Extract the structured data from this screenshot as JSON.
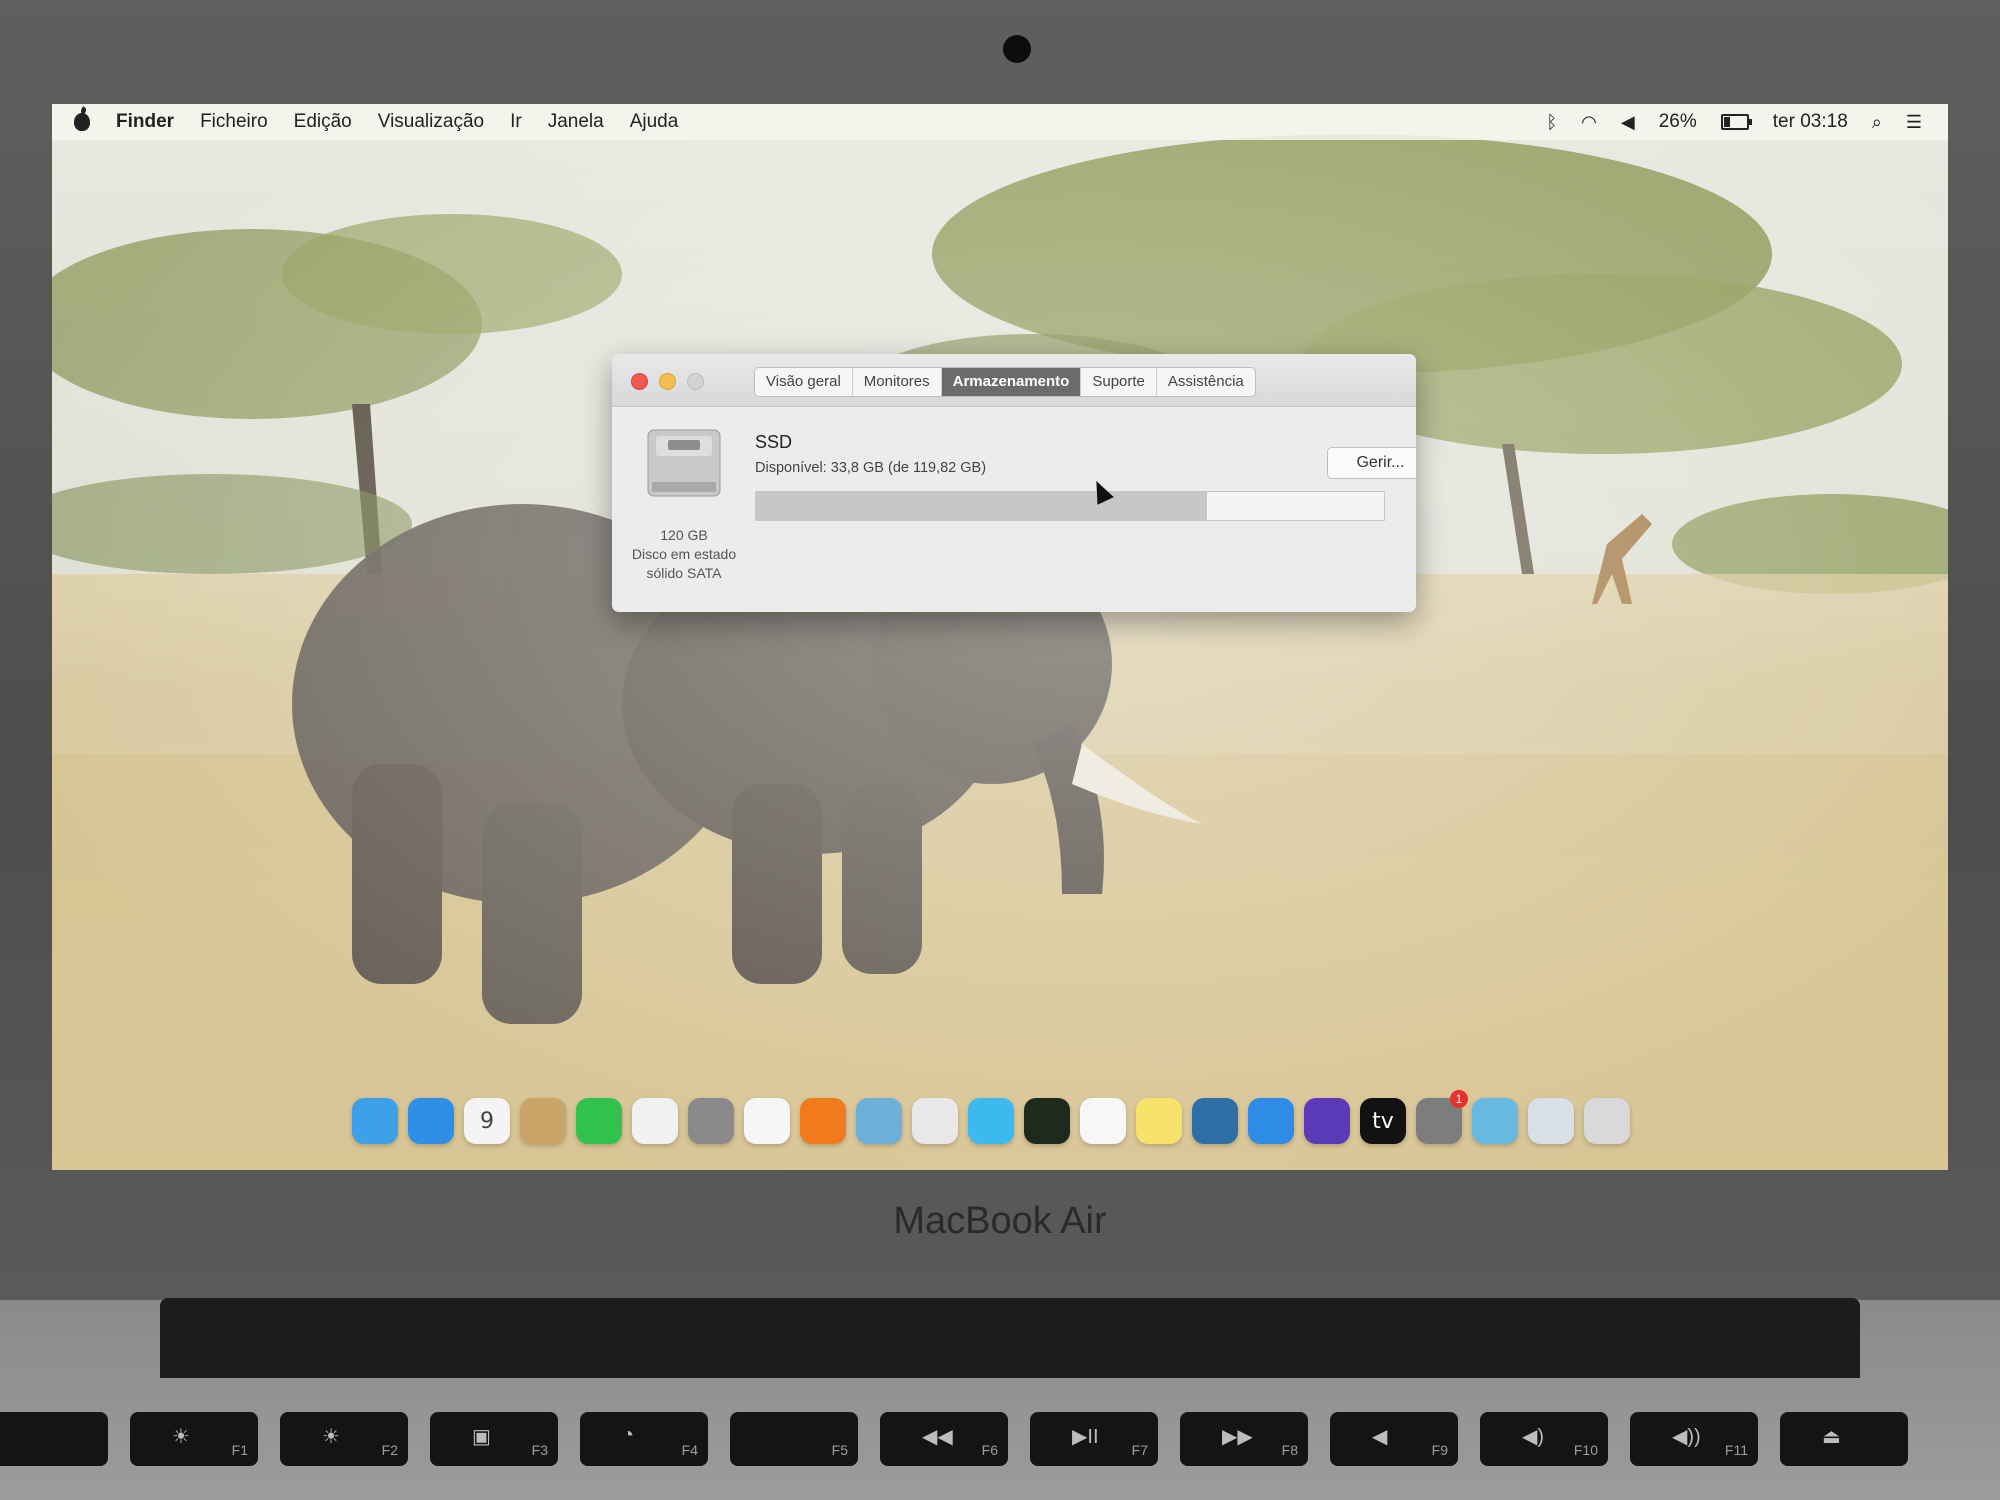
{
  "menubar": {
    "app_name": "Finder",
    "menus": [
      "Ficheiro",
      "Edição",
      "Visualização",
      "Ir",
      "Janela",
      "Ajuda"
    ],
    "battery_percent_label": "26%",
    "battery_level": 0.26,
    "clock": "ter 03:18",
    "icons": [
      "bluetooth-icon",
      "wifi-icon",
      "volume-icon",
      "battery-icon",
      "spotlight-icon",
      "notification-center-icon"
    ]
  },
  "about_window": {
    "tabs": [
      "Visão geral",
      "Monitores",
      "Armazenamento",
      "Suporte",
      "Assistência"
    ],
    "active_tab": "Armazenamento",
    "disk": {
      "name": "SSD",
      "available": "Disponível: 33,8 GB (de 119,82 GB)",
      "size": "120 GB",
      "type_line1": "Disco em estado",
      "type_line2": "sólido SATA",
      "used_fraction": 0.718
    },
    "manage_button": "Gerir..."
  },
  "dock": {
    "items": [
      {
        "name": "finder-icon",
        "color": "#3ea0e8"
      },
      {
        "name": "app-store-icon",
        "color": "#2f8fe6"
      },
      {
        "name": "calendar-icon",
        "color": "#f4f4f4",
        "text": "9"
      },
      {
        "name": "contacts-icon",
        "color": "#c9a56a"
      },
      {
        "name": "facetime-icon",
        "color": "#31c24d"
      },
      {
        "name": "photos-icon",
        "color": "#f1f1f1"
      },
      {
        "name": "launchpad-icon",
        "color": "#8a8a8a"
      },
      {
        "name": "reminders-icon",
        "color": "#f6f6f6"
      },
      {
        "name": "books-icon",
        "color": "#f07a1c"
      },
      {
        "name": "preview-icon",
        "color": "#6ab0d8"
      },
      {
        "name": "script-editor-icon",
        "color": "#e8e8e8"
      },
      {
        "name": "messages-icon",
        "color": "#3cb9ef"
      },
      {
        "name": "activity-monitor-icon",
        "color": "#1e2a1e"
      },
      {
        "name": "music-icon",
        "color": "#f7f7f7"
      },
      {
        "name": "notes-icon",
        "color": "#f7e36a"
      },
      {
        "name": "quicktime-icon",
        "color": "#2d6fa6"
      },
      {
        "name": "safari-icon",
        "color": "#2f8ce6"
      },
      {
        "name": "siri-icon",
        "color": "#5b3ab8"
      },
      {
        "name": "apple-tv-icon",
        "color": "#111111",
        "text": "tv"
      },
      {
        "name": "system-preferences-icon",
        "color": "#7d7d7d",
        "badge": "1"
      },
      {
        "name": "downloads-folder-icon",
        "color": "#67b9e0"
      },
      {
        "name": "finder-window-icon",
        "color": "#d8dfe6"
      },
      {
        "name": "trash-icon",
        "color": "#d9d9d9"
      }
    ]
  },
  "hardware": {
    "brand": "MacBook Air",
    "keys": [
      {
        "label": "",
        "glyph": ""
      },
      {
        "label": "F1",
        "glyph": "☀"
      },
      {
        "label": "F2",
        "glyph": "☀"
      },
      {
        "label": "F3",
        "glyph": "▣"
      },
      {
        "label": "F4",
        "glyph": "◔"
      },
      {
        "label": "F5",
        "glyph": ""
      },
      {
        "label": "F6",
        "glyph": "◀◀"
      },
      {
        "label": "F7",
        "glyph": "▶II"
      },
      {
        "label": "F8",
        "glyph": "▶▶"
      },
      {
        "label": "F9",
        "glyph": "◀"
      },
      {
        "label": "F10",
        "glyph": "◀)"
      },
      {
        "label": "F11",
        "glyph": "◀))"
      },
      {
        "label": "",
        "glyph": "⏏"
      }
    ]
  }
}
